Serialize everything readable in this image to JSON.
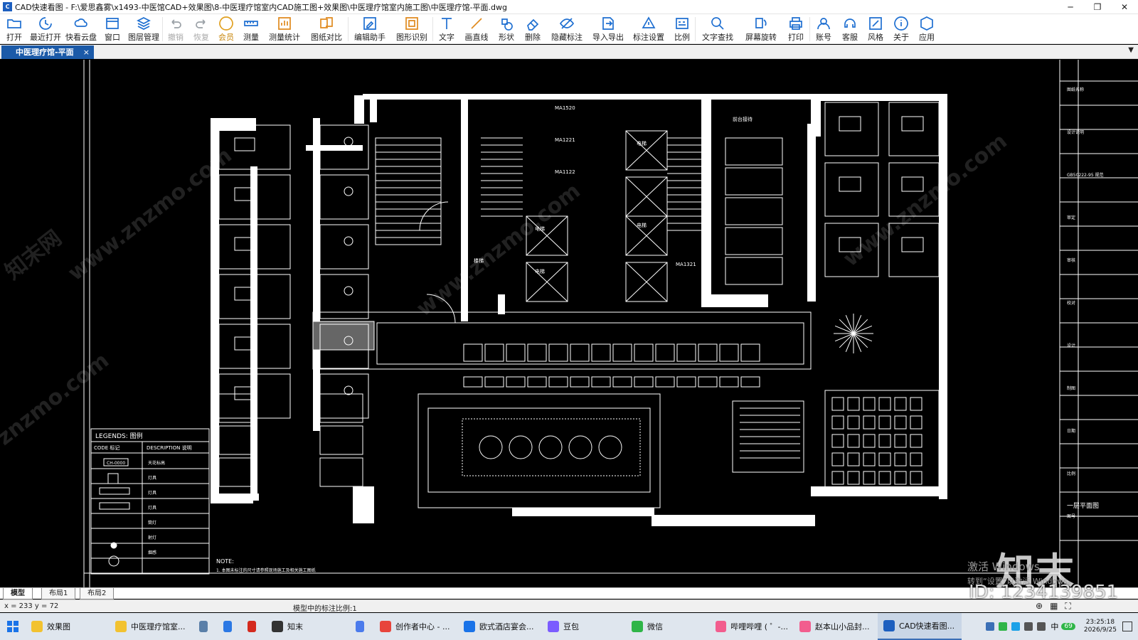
{
  "window": {
    "title": "CAD快速看图 - F:\\爱思鑫雾\\x1493-中医馆CAD+效果图\\8-中医理疗馆室内CAD施工图+效果图\\中医理疗馆室内施工图\\中医理疗馆-平面.dwg",
    "minimize": "─",
    "restore": "❐",
    "close": "✕"
  },
  "toolbar": {
    "items": [
      {
        "label": "打开",
        "icon": "folder-open-icon",
        "color": "#1e6fd1"
      },
      {
        "label": "最近打开",
        "icon": "history-icon",
        "color": "#1e6fd1"
      },
      {
        "label": "快看云盘",
        "icon": "cloud-icon",
        "color": "#1e6fd1"
      },
      {
        "label": "窗口",
        "icon": "window-icon",
        "color": "#1e6fd1"
      },
      {
        "label": "图层管理",
        "icon": "layers-icon",
        "color": "#1e6fd1"
      },
      {
        "label": "撤销",
        "icon": "undo-icon",
        "color": "#9aa0a6",
        "disabled": true
      },
      {
        "label": "恢复",
        "icon": "redo-icon",
        "color": "#9aa0a6",
        "disabled": true
      },
      {
        "label": "会员",
        "icon": "vip-icon",
        "color": "#e0a020",
        "vip": true
      },
      {
        "label": "测量",
        "icon": "measure-icon",
        "color": "#1e6fd1"
      },
      {
        "label": "测量统计",
        "icon": "measure-stats-icon",
        "color": "#e08a1e"
      },
      {
        "label": "图纸对比",
        "icon": "compare-icon",
        "color": "#e08a1e"
      },
      {
        "label": "编辑助手",
        "icon": "edit-assistant-icon",
        "color": "#1e6fd1"
      },
      {
        "label": "图形识别",
        "icon": "shape-recognize-icon",
        "color": "#e08a1e"
      },
      {
        "label": "文字",
        "icon": "text-icon",
        "color": "#1e6fd1"
      },
      {
        "label": "画直线",
        "icon": "line-icon",
        "color": "#e08a1e"
      },
      {
        "label": "形状",
        "icon": "shape-icon",
        "color": "#1e6fd1"
      },
      {
        "label": "删除",
        "icon": "eraser-icon",
        "color": "#1e6fd1"
      },
      {
        "label": "隐藏标注",
        "icon": "hide-annotation-icon",
        "color": "#1e6fd1"
      },
      {
        "label": "导入导出",
        "icon": "import-export-icon",
        "color": "#1e6fd1"
      },
      {
        "label": "标注设置",
        "icon": "annotation-settings-icon",
        "color": "#1e6fd1"
      },
      {
        "label": "比例",
        "icon": "scale-icon",
        "color": "#1e6fd1"
      },
      {
        "label": "文字查找",
        "icon": "text-search-icon",
        "color": "#1e6fd1"
      },
      {
        "label": "屏幕旋转",
        "icon": "rotate-screen-icon",
        "color": "#1e6fd1"
      },
      {
        "label": "打印",
        "icon": "print-icon",
        "color": "#1e6fd1"
      },
      {
        "label": "账号",
        "icon": "account-icon",
        "color": "#1e6fd1"
      },
      {
        "label": "客服",
        "icon": "support-icon",
        "color": "#1e6fd1"
      },
      {
        "label": "风格",
        "icon": "style-icon",
        "color": "#1e6fd1"
      },
      {
        "label": "关于",
        "icon": "about-icon",
        "color": "#1e6fd1"
      },
      {
        "label": "应用",
        "icon": "apps-icon",
        "color": "#1e6fd1"
      }
    ]
  },
  "tabs": {
    "active": "中医理疗馆-平面",
    "close": "×",
    "dropdown": "▼"
  },
  "drawing": {
    "background": "#000000",
    "line_color": "#ffffff",
    "legend": {
      "title": "LEGENDS: 图例",
      "col_code": "CODE  标记",
      "col_desc": "DESCRIPTION  说明",
      "rows": [
        "CH-0000",
        "",
        "",
        "",
        "",
        "",
        ""
      ],
      "row_desc": [
        "天花标高",
        "灯具",
        "灯具",
        "灯具",
        "筒灯",
        "射灯",
        "烟感"
      ]
    },
    "note": "NOTE:",
    "note_line": "1. 本图未标注的尺寸请参照现场施工及相关施工图纸",
    "title_block": {
      "rows": [
        "图纸名称",
        "设计说明",
        "GB50222-95 规范",
        "审定",
        "审核",
        "校对",
        "设计",
        "制图",
        "日期",
        "比例",
        "图号"
      ],
      "bottom": "一层平面图"
    },
    "room_labels": [
      "前台接待",
      "MA1321",
      "MA1520",
      "MA1221",
      "MA1122",
      "电梯",
      "电梯",
      "电梯",
      "电梯",
      "楼梯"
    ]
  },
  "watermarks": [
    "www.znzmo.com",
    "www.znzmo.com",
    "www.znzmo.com",
    "znzmo.com",
    "知末网"
  ],
  "activation": {
    "line1": "激活 Windows",
    "line2": "转到“设置”以激活 Windows。"
  },
  "brand_logo": "知末",
  "id_label": "ID: 1234139851",
  "layout_tabs": [
    "模型",
    "布局1",
    "布局2"
  ],
  "status": {
    "coords": "x = 233  y = 72",
    "scale": "模型中的标注比例:1"
  },
  "taskbar": {
    "items": [
      {
        "label": "效果图",
        "color": "#f2c230"
      },
      {
        "label": "中医理疗馆室...",
        "color": "#f2c230"
      },
      {
        "label": "",
        "color": "#5a7fa8"
      },
      {
        "label": "",
        "color": "#2b78e4"
      },
      {
        "label": "",
        "color": "#d42a1e"
      },
      {
        "label": "知末",
        "color": "#333333"
      },
      {
        "label": "",
        "color": "#4b7bec"
      },
      {
        "label": "创作者中心 - ...",
        "color": "#e8453c"
      },
      {
        "label": "欧式酒店宴会...",
        "color": "#1a73e8"
      },
      {
        "label": "豆包",
        "color": "#7b5cff"
      },
      {
        "label": "微信",
        "color": "#2fb548"
      },
      {
        "label": "哔哩哔哩 ( ゜-...",
        "color": "#f25d8e"
      },
      {
        "label": "赵本山小品封...",
        "color": "#f25d8e"
      },
      {
        "label": "CAD快速看图...",
        "color": "#1d5fbf",
        "active": true
      }
    ],
    "clock_time": "23:25:18",
    "clock_date": "2026/9/25",
    "ime": "中",
    "badge": "69"
  }
}
